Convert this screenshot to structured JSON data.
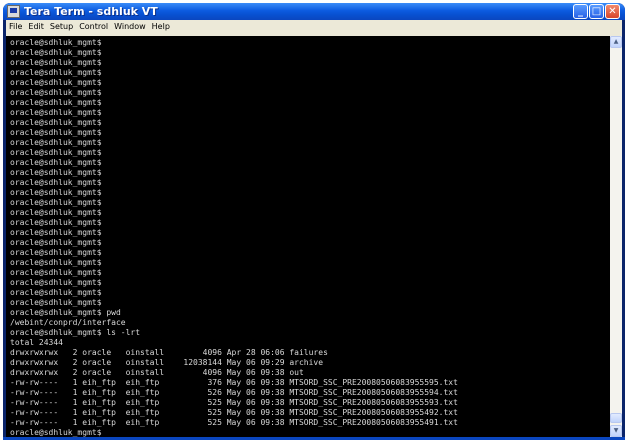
{
  "window": {
    "title": "Tera Term - sdhluk VT",
    "controls": {
      "minimize": "_",
      "maximize": "□",
      "close": "✕"
    }
  },
  "menu": [
    "File",
    "Edit",
    "Setup",
    "Control",
    "Window",
    "Help"
  ],
  "terminal": {
    "lines": [
      "oracle@sdhluk_mgmt$",
      "oracle@sdhluk_mgmt$",
      "oracle@sdhluk_mgmt$",
      "oracle@sdhluk_mgmt$",
      "oracle@sdhluk_mgmt$",
      "oracle@sdhluk_mgmt$",
      "oracle@sdhluk_mgmt$",
      "oracle@sdhluk_mgmt$",
      "oracle@sdhluk_mgmt$",
      "oracle@sdhluk_mgmt$",
      "oracle@sdhluk_mgmt$",
      "oracle@sdhluk_mgmt$",
      "oracle@sdhluk_mgmt$",
      "oracle@sdhluk_mgmt$",
      "oracle@sdhluk_mgmt$",
      "oracle@sdhluk_mgmt$",
      "oracle@sdhluk_mgmt$",
      "oracle@sdhluk_mgmt$",
      "oracle@sdhluk_mgmt$",
      "oracle@sdhluk_mgmt$",
      "oracle@sdhluk_mgmt$",
      "oracle@sdhluk_mgmt$",
      "oracle@sdhluk_mgmt$",
      "oracle@sdhluk_mgmt$",
      "oracle@sdhluk_mgmt$",
      "oracle@sdhluk_mgmt$",
      "oracle@sdhluk_mgmt$",
      "oracle@sdhluk_mgmt$ pwd",
      "/webint/conprd/interface",
      "oracle@sdhluk_mgmt$ ls -lrt",
      "total 24344",
      "drwxrwxrwx   2 oracle   oinstall        4096 Apr 28 06:06 failures",
      "drwxrwxrwx   2 oracle   oinstall    12038144 May 06 09:29 archive",
      "drwxrwxrwx   2 oracle   oinstall        4096 May 06 09:38 out",
      "-rw-rw----   1 eih_ftp  eih_ftp          376 May 06 09:38 MTSORD_SSC_PRE20080506083955595.txt",
      "-rw-rw----   1 eih_ftp  eih_ftp          526 May 06 09:38 MTSORD_SSC_PRE20080506083955594.txt",
      "-rw-rw----   1 eih_ftp  eih_ftp          525 May 06 09:38 MTSORD_SSC_PRE20080506083955593.txt",
      "-rw-rw----   1 eih_ftp  eih_ftp          525 May 06 09:38 MTSORD_SSC_PRE20080506083955492.txt",
      "-rw-rw----   1 eih_ftp  eih_ftp          525 May 06 09:38 MTSORD_SSC_PRE20080506083955491.txt",
      "oracle@sdhluk_mgmt$"
    ]
  },
  "scrollbar": {
    "up": "▲",
    "down": "▼"
  }
}
